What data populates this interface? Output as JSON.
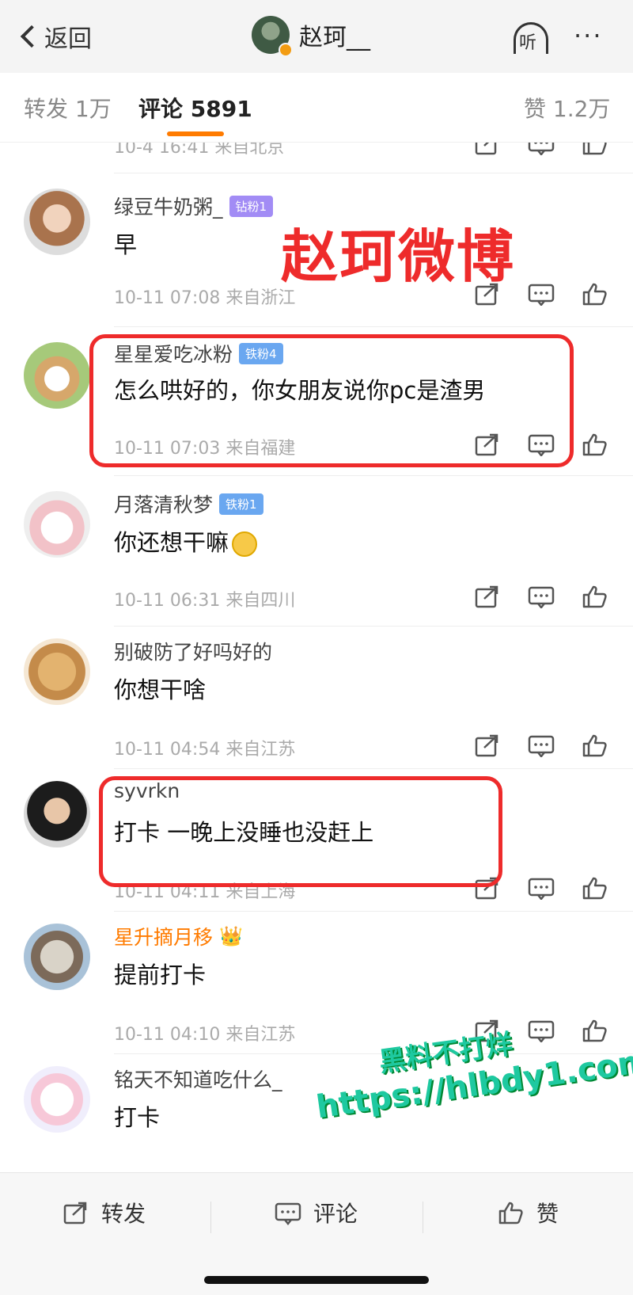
{
  "header": {
    "back_label": "返回",
    "title": "赵珂__",
    "listen_label": "听",
    "more_label": "···"
  },
  "tabs": {
    "repost": "转发 1万",
    "comments": "评论 5891",
    "likes": "赞 1.2万"
  },
  "overlay_title": "赵珂微博",
  "watermark": {
    "line1": "黑料不打烊",
    "line2": "https://hlbdy1.com"
  },
  "partial_meta": "10-4 16:41 来自北京",
  "comments": [
    {
      "name": "绿豆牛奶粥_",
      "badge": "钻粉1",
      "text": "早",
      "meta": "10-11 07:08 来自浙江"
    },
    {
      "name": "星星爱吃冰粉",
      "badge": "铁粉4",
      "text": "怎么哄好的，你女朋友说你pc是渣男",
      "meta": "10-11 07:03 来自福建"
    },
    {
      "name": "月落清秋梦",
      "badge": "铁粉1",
      "text": "你还想干嘛",
      "meta": "10-11 06:31 来自四川"
    },
    {
      "name": "别破防了好吗好的",
      "text": "你想干啥",
      "meta": "10-11 04:54 来自江苏"
    },
    {
      "name": "syvrkn",
      "text": "打卡 一晚上没睡也没赶上",
      "meta": "10-11 04:11 来自上海"
    },
    {
      "name": "星升摘月移",
      "text": "提前打卡",
      "meta": "10-11 04:10 来自江苏"
    },
    {
      "name": "铭天不知道吃什么_",
      "text": "打卡"
    }
  ],
  "bottombar": {
    "repost": "转发",
    "comment": "评论",
    "like": "赞"
  },
  "colors": {
    "accent": "#ff7b00",
    "highlight_box": "#ee2b2b",
    "watermark": "#1ec9a0"
  }
}
